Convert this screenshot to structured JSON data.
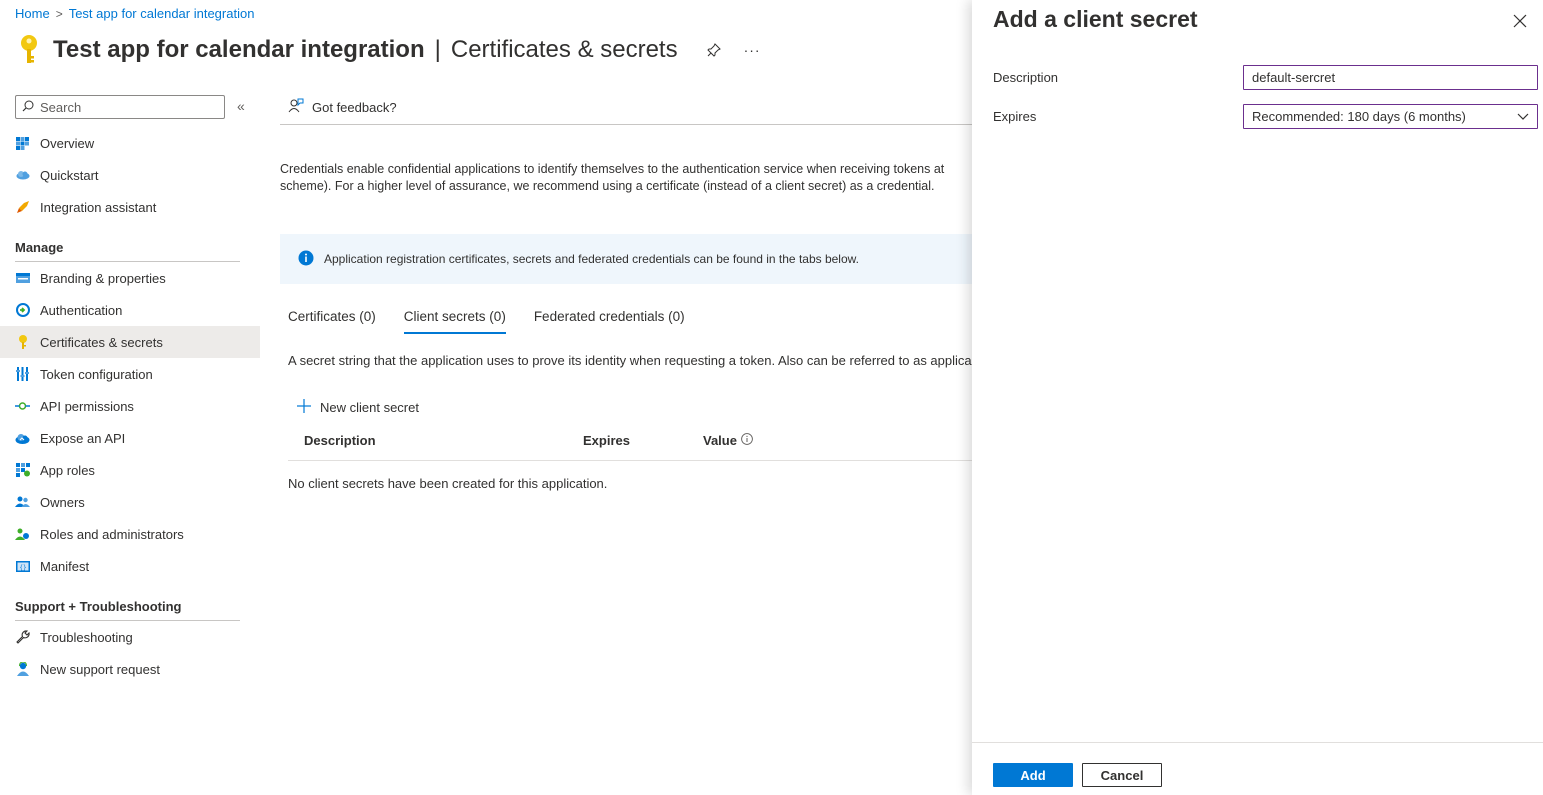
{
  "breadcrumb": {
    "home": "Home",
    "separator": ">",
    "app": "Test app for calendar integration"
  },
  "header": {
    "title": "Test app for calendar integration",
    "pipe": "|",
    "subtitle": "Certificates & secrets",
    "more": "···",
    "icon": "key-icon"
  },
  "sidebar": {
    "search_placeholder": "Search",
    "collapse": "«",
    "items_top": [
      {
        "label": "Overview",
        "icon": "overview-grid-icon"
      },
      {
        "label": "Quickstart",
        "icon": "cloud-icon"
      },
      {
        "label": "Integration assistant",
        "icon": "rocket-icon"
      }
    ],
    "manage_header": "Manage",
    "items_manage": [
      {
        "label": "Branding & properties",
        "icon": "branding-icon"
      },
      {
        "label": "Authentication",
        "icon": "authentication-icon"
      },
      {
        "label": "Certificates & secrets",
        "icon": "key-icon",
        "active": true
      },
      {
        "label": "Token configuration",
        "icon": "token-icon"
      },
      {
        "label": "API permissions",
        "icon": "api-permissions-icon"
      },
      {
        "label": "Expose an API",
        "icon": "cloud-api-icon"
      },
      {
        "label": "App roles",
        "icon": "app-roles-icon"
      },
      {
        "label": "Owners",
        "icon": "owners-icon"
      },
      {
        "label": "Roles and administrators",
        "icon": "roles-admin-icon"
      },
      {
        "label": "Manifest",
        "icon": "manifest-icon"
      }
    ],
    "support_header": "Support + Troubleshooting",
    "items_support": [
      {
        "label": "Troubleshooting",
        "icon": "wrench-icon"
      },
      {
        "label": "New support request",
        "icon": "support-person-icon"
      }
    ]
  },
  "main": {
    "feedback": "Got feedback?",
    "description_line1": "Credentials enable confidential applications to identify themselves to the authentication service when receiving tokens at",
    "description_line2": "scheme). For a higher level of assurance, we recommend using a certificate (instead of a client secret) as a credential.",
    "info": "Application registration certificates, secrets and federated credentials can be found in the tabs below.",
    "tabs": [
      {
        "label": "Certificates (0)",
        "active": false
      },
      {
        "label": "Client secrets (0)",
        "active": true
      },
      {
        "label": "Federated credentials (0)",
        "active": false
      }
    ],
    "tab_description": "A secret string that the application uses to prove its identity when requesting a token. Also can be referred to as applica",
    "new_secret": "New client secret",
    "table": {
      "columns": [
        "Description",
        "Expires",
        "Value"
      ],
      "empty": "No client secrets have been created for this application."
    }
  },
  "panel": {
    "title": "Add a client secret",
    "description_label": "Description",
    "description_value": "default-sercret",
    "expires_label": "Expires",
    "expires_value": "Recommended: 180 days (6 months)",
    "add": "Add",
    "cancel": "Cancel"
  },
  "colors": {
    "accent": "#0078d4",
    "field_border": "#6b2f8e",
    "info_bg": "#eff6fc",
    "active_nav": "#edebe9"
  }
}
